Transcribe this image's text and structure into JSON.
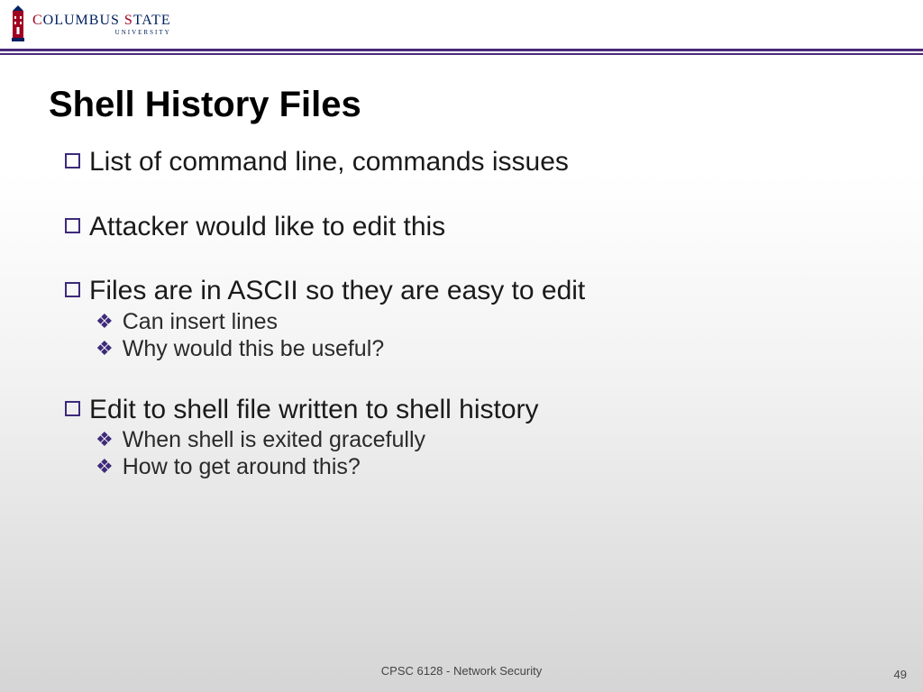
{
  "logo": {
    "line1_part1": "C",
    "line1_part2": "OLUMBUS ",
    "line1_part3": "S",
    "line1_part4": "TATE",
    "line2": "UNIVERSITY"
  },
  "title": "Shell History Files",
  "bullets": [
    {
      "text": "List of command line, commands issues",
      "subs": []
    },
    {
      "text": "Attacker would like to edit this",
      "subs": []
    },
    {
      "text": "Files are in ASCII so they are easy to edit",
      "subs": [
        "Can insert lines",
        "Why would this be useful?"
      ]
    },
    {
      "text": "Edit to shell file written to shell history",
      "subs": [
        "When shell is exited gracefully",
        "How to get around this?"
      ]
    }
  ],
  "footer": {
    "course": "CPSC 6128 - Network Security",
    "page": "49"
  }
}
